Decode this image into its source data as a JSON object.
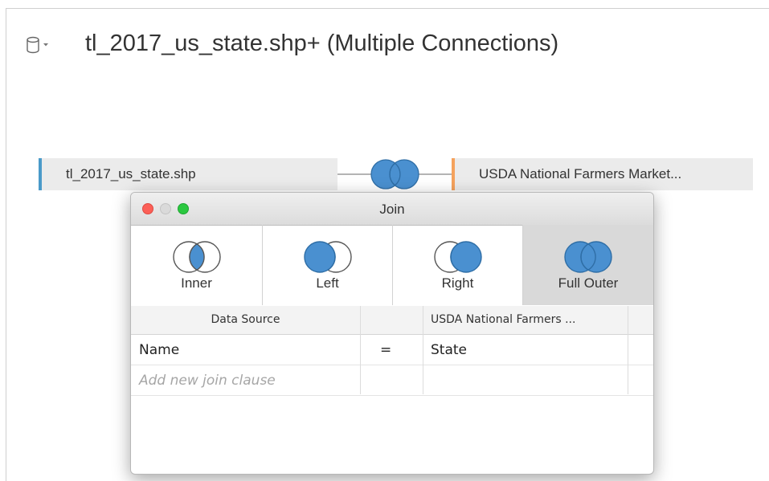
{
  "data_source": {
    "icon": "database-icon",
    "title": "tl_2017_us_state.shp+ (Multiple Connections)"
  },
  "canvas": {
    "left_table": {
      "name": "tl_2017_us_state.shp",
      "accent_color": "#4a9ac9"
    },
    "right_table": {
      "name": "USDA National Farmers Market...",
      "accent_color": "#f5a25d"
    },
    "join_icon": "full-outer-join-icon"
  },
  "dialog": {
    "title": "Join",
    "join_types": [
      {
        "label": "Inner",
        "icon": "inner-join-icon"
      },
      {
        "label": "Left",
        "icon": "left-join-icon"
      },
      {
        "label": "Right",
        "icon": "right-join-icon"
      },
      {
        "label": "Full Outer",
        "icon": "full-outer-join-icon",
        "selected": true
      }
    ],
    "clause_table": {
      "headers": [
        "Data Source",
        "",
        "USDA National Farmers ..."
      ],
      "rows": [
        {
          "left": "Name",
          "operator": "=",
          "right": "State"
        }
      ],
      "add_clause_placeholder": "Add new join clause"
    }
  },
  "colors": {
    "join_fill": "#4a90d0",
    "selected_join_bg": "#d9d9d9"
  }
}
